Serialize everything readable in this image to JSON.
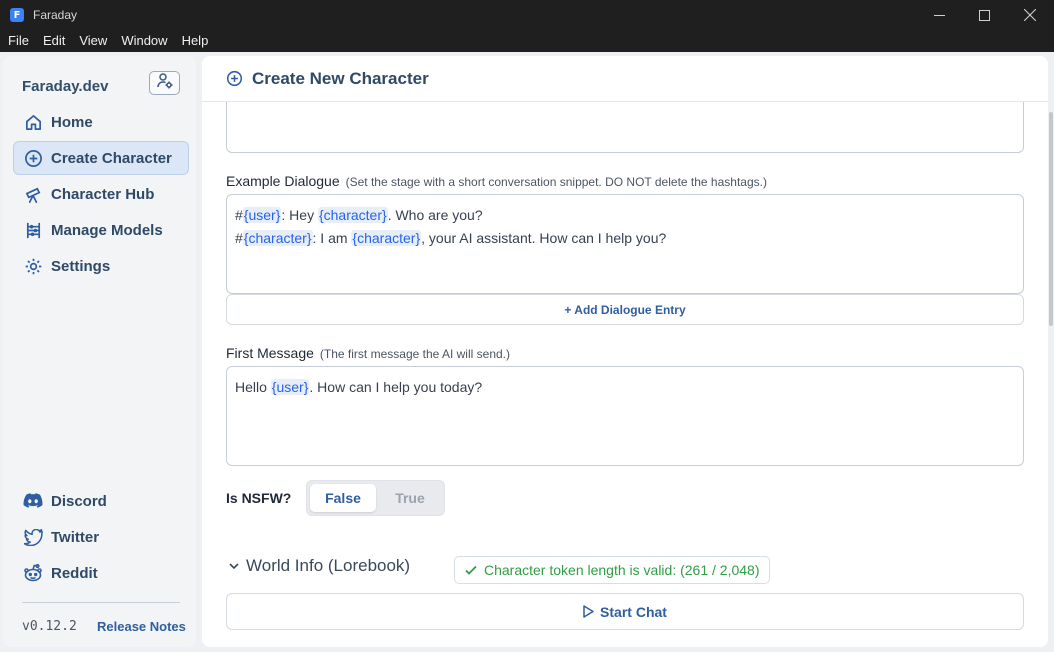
{
  "window": {
    "title": "Faraday"
  },
  "menu": [
    "File",
    "Edit",
    "View",
    "Window",
    "Help"
  ],
  "sidebar": {
    "brand": "Faraday.dev",
    "nav": [
      {
        "label": "Home",
        "icon": "home-icon"
      },
      {
        "label": "Create Character",
        "icon": "plus-circle-icon",
        "active": true
      },
      {
        "label": "Character Hub",
        "icon": "telescope-icon"
      },
      {
        "label": "Manage Models",
        "icon": "abacus-icon"
      },
      {
        "label": "Settings",
        "icon": "gear-icon"
      }
    ],
    "social": [
      {
        "label": "Discord",
        "icon": "discord-icon"
      },
      {
        "label": "Twitter",
        "icon": "twitter-icon"
      },
      {
        "label": "Reddit",
        "icon": "reddit-icon"
      }
    ],
    "version": "v0.12.2",
    "release_notes": "Release Notes"
  },
  "main": {
    "title": "Create New Character",
    "example_dialogue": {
      "label": "Example Dialogue",
      "hint": "(Set the stage with a short conversation snippet. DO NOT delete the hashtags.)",
      "lines": [
        {
          "prefix": "#",
          "speaker": "{user}",
          "sep": ": Hey ",
          "mention": "{character}",
          "rest": ". Who are you?"
        },
        {
          "prefix": "#",
          "speaker": "{character}",
          "sep": ": I am ",
          "mention": "{character}",
          "rest": ", your AI assistant. How can I help you?"
        }
      ],
      "add_label": "+ Add Dialogue Entry"
    },
    "first_message": {
      "label": "First Message",
      "hint": "(The first message the AI will send.)",
      "pre": "Hello ",
      "token": "{user}",
      "post": ". How can I help you today?"
    },
    "nsfw": {
      "label": "Is NSFW?",
      "options": [
        "False",
        "True"
      ],
      "selected": "False"
    },
    "world_info": "World Info (Lorebook)",
    "token_status": "Character token length is valid: (261 / 2,048)",
    "start_chat": "Start Chat"
  },
  "colors": {
    "accent": "#2f5fa0",
    "valid": "#2f9e44",
    "sidebar_active": "#dbe7f7"
  }
}
